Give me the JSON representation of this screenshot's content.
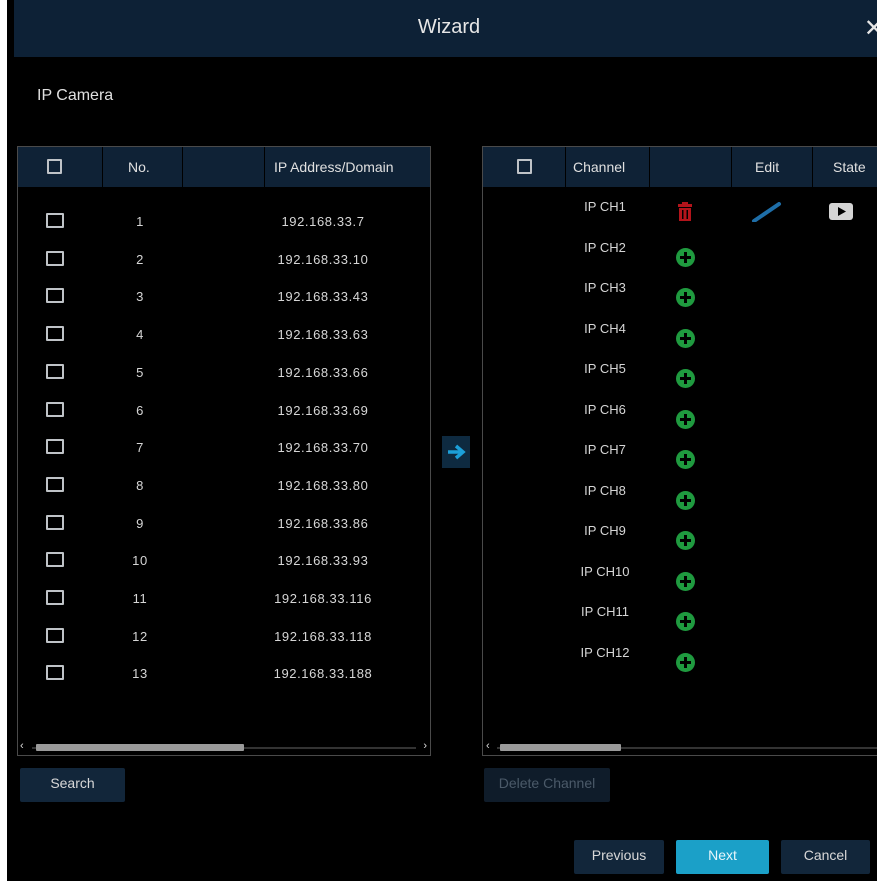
{
  "window": {
    "title": "Wizard",
    "close_glyph": "✕"
  },
  "section_label": "IP Camera",
  "left_table": {
    "headers": {
      "no": "No.",
      "ip": "IP Address/Domain"
    },
    "rows": [
      {
        "no": "1",
        "ip": "192.168.33.7"
      },
      {
        "no": "2",
        "ip": "192.168.33.10"
      },
      {
        "no": "3",
        "ip": "192.168.33.43"
      },
      {
        "no": "4",
        "ip": "192.168.33.63"
      },
      {
        "no": "5",
        "ip": "192.168.33.66"
      },
      {
        "no": "6",
        "ip": "192.168.33.69"
      },
      {
        "no": "7",
        "ip": "192.168.33.70"
      },
      {
        "no": "8",
        "ip": "192.168.33.80"
      },
      {
        "no": "9",
        "ip": "192.168.33.86"
      },
      {
        "no": "10",
        "ip": "192.168.33.93"
      },
      {
        "no": "11",
        "ip": "192.168.33.116"
      },
      {
        "no": "12",
        "ip": "192.168.33.118"
      },
      {
        "no": "13",
        "ip": "192.168.33.188"
      }
    ],
    "scroll_arrows": {
      "left": "‹",
      "right": "›"
    }
  },
  "right_table": {
    "headers": {
      "channel": "Channel",
      "edit": "Edit",
      "state": "State"
    },
    "rows": [
      {
        "channel": "IP CH1",
        "action_icon": "delete-icon"
      },
      {
        "channel": "IP CH2",
        "action_icon": "add-icon"
      },
      {
        "channel": "IP CH3",
        "action_icon": "add-icon"
      },
      {
        "channel": "IP CH4",
        "action_icon": "add-icon"
      },
      {
        "channel": "IP CH5",
        "action_icon": "add-icon"
      },
      {
        "channel": "IP CH6",
        "action_icon": "add-icon"
      },
      {
        "channel": "IP CH7",
        "action_icon": "add-icon"
      },
      {
        "channel": "IP CH8",
        "action_icon": "add-icon"
      },
      {
        "channel": "IP CH9",
        "action_icon": "add-icon"
      },
      {
        "channel": "IP CH10",
        "action_icon": "add-icon"
      },
      {
        "channel": "IP CH11",
        "action_icon": "add-icon"
      },
      {
        "channel": "IP CH12",
        "action_icon": "add-icon"
      }
    ],
    "scroll_arrows": {
      "left": "‹"
    }
  },
  "buttons": {
    "search": "Search",
    "delete_channel": "Delete Channel",
    "previous": "Previous",
    "next": "Next",
    "cancel": "Cancel"
  },
  "colors": {
    "header_bg": "#0f2236",
    "accent_next": "#1ba0c8",
    "add_green": "#1f9a3f",
    "delete_red": "#b3141b",
    "edit_blue": "#1e6ea8",
    "move_arrow_blue": "#1c9fd8"
  }
}
